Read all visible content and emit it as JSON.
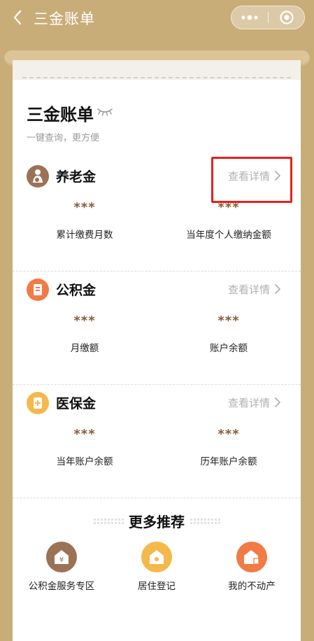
{
  "nav": {
    "title": "三金账单",
    "back_glyph": "‹"
  },
  "card": {
    "title": "三金账单",
    "subtitle": "一键查询，更方便"
  },
  "sections": [
    {
      "name": "养老金",
      "detail": "查看详情",
      "icon": "pension-icon",
      "color": "#9b7256",
      "items": [
        {
          "value": "***",
          "label": "累计缴费月数"
        },
        {
          "value": "***",
          "label": "当年度个人缴纳金额"
        }
      ]
    },
    {
      "name": "公积金",
      "detail": "查看详情",
      "icon": "housing-fund-icon",
      "color": "#f27a45",
      "items": [
        {
          "value": "***",
          "label": "月缴额"
        },
        {
          "value": "***",
          "label": "账户余额"
        }
      ]
    },
    {
      "name": "医保金",
      "detail": "查看详情",
      "icon": "medical-insurance-icon",
      "color": "#f5b84a",
      "items": [
        {
          "value": "***",
          "label": "当年账户余额"
        },
        {
          "value": "***",
          "label": "历年账户余额"
        }
      ]
    }
  ],
  "more": {
    "title": "更多推荐",
    "items": [
      {
        "label": "公积金服务专区",
        "icon": "housing-fund-service-icon",
        "color": "#9b7256"
      },
      {
        "label": "居住登记",
        "icon": "residence-registration-icon",
        "color": "#f5b84a"
      },
      {
        "label": "我的不动产",
        "icon": "real-estate-icon",
        "color": "#f27a45"
      }
    ]
  },
  "colors": {
    "background": "#c9ad78",
    "highlight": "#e4221d",
    "value_text": "#8a5b3a"
  }
}
